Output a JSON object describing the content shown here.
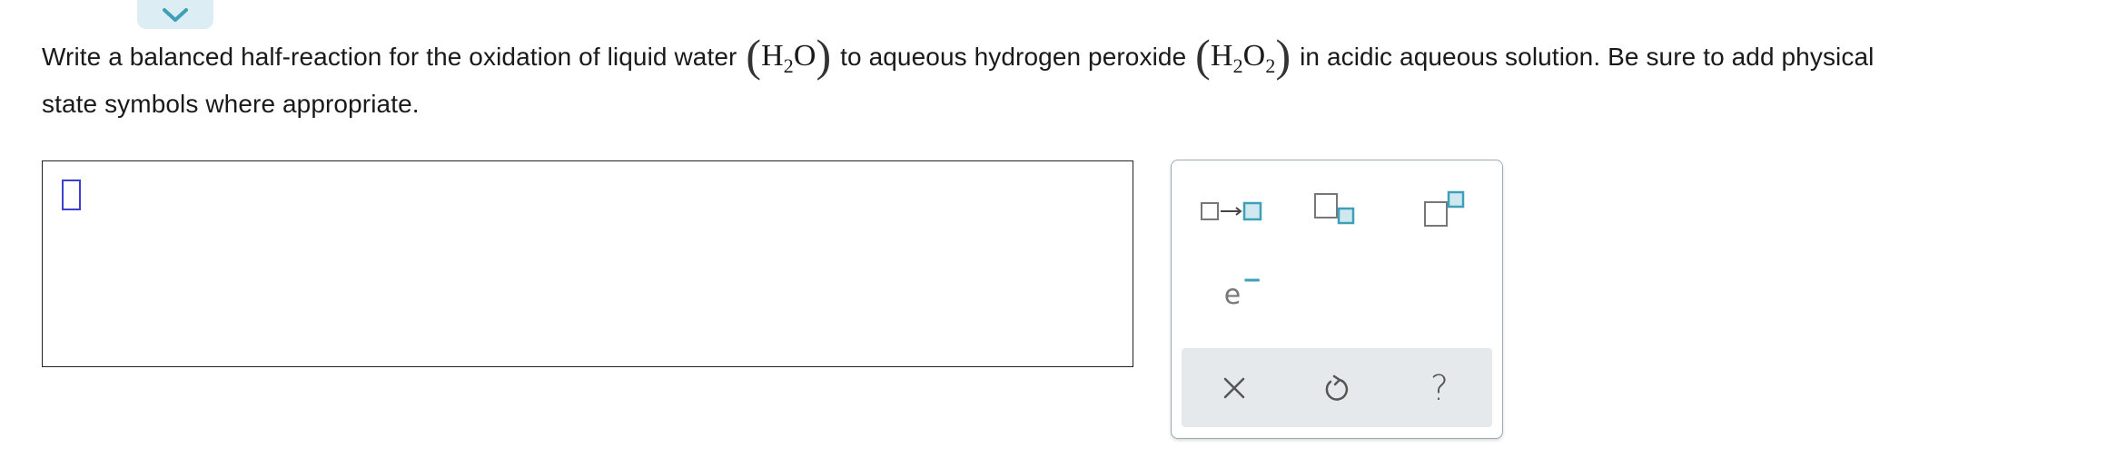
{
  "prompt": {
    "line1_before_water": "Write a balanced half-reaction for the oxidation of liquid water",
    "water_formula": {
      "el1": "H",
      "sub1": "2",
      "el2": "O"
    },
    "line1_middle": "to aqueous hydrogen peroxide",
    "peroxide_formula": {
      "el1": "H",
      "sub1": "2",
      "el2": "O",
      "sub2": "2"
    },
    "line1_after_peroxide": "in acidic aqueous solution. Be sure to add physical",
    "line2": "state symbols where appropriate."
  },
  "palette": {
    "electron_symbol": "e",
    "electron_charge": "−",
    "help_label": "?"
  },
  "colors": {
    "accent": "#3d9fb8",
    "cursor_blue": "#3d3fd1",
    "tab_bg": "#dceef3",
    "action_bar_bg": "#e6e9ec"
  }
}
